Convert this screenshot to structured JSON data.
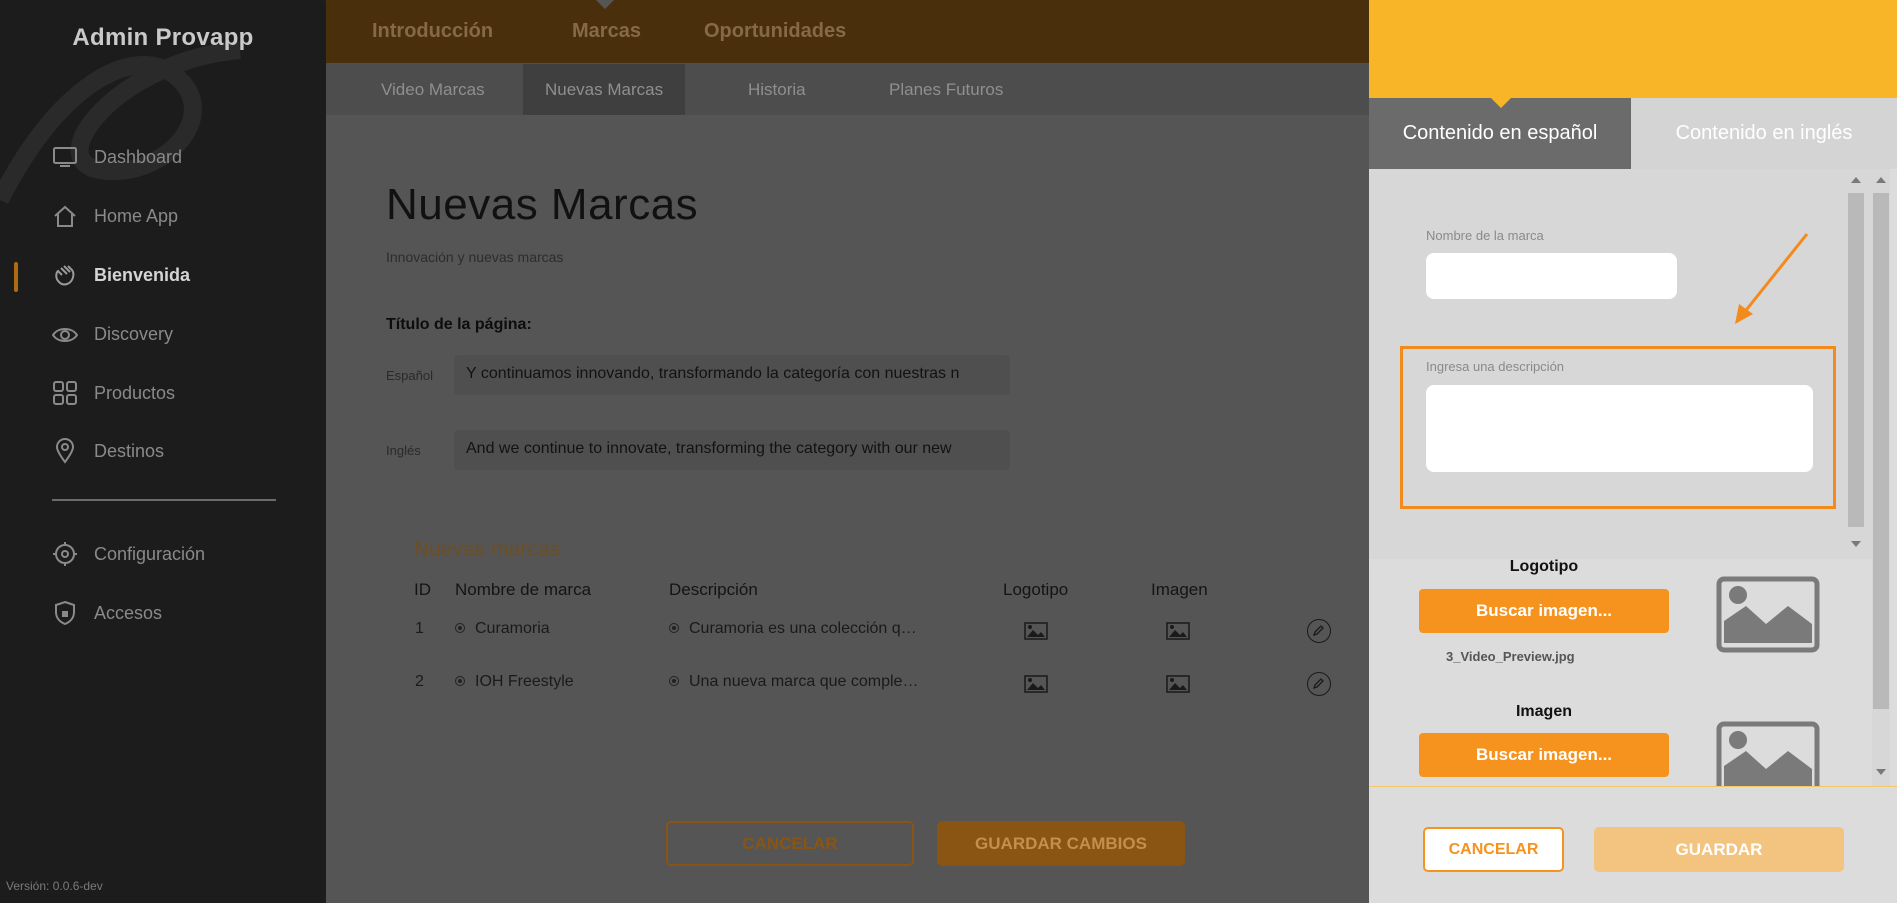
{
  "sidebar": {
    "app_title": "Admin Provapp",
    "items": [
      {
        "label": "Dashboard",
        "icon": "monitor-icon"
      },
      {
        "label": "Home App",
        "icon": "home-icon"
      },
      {
        "label": "Bienvenida",
        "icon": "wave-hand-icon",
        "active": true
      },
      {
        "label": "Discovery",
        "icon": "eye-icon"
      },
      {
        "label": "Productos",
        "icon": "grid-icon"
      },
      {
        "label": "Destinos",
        "icon": "map-pin-icon"
      },
      {
        "label": "Configuración",
        "icon": "gear-icon"
      },
      {
        "label": "Accesos",
        "icon": "shield-icon"
      }
    ],
    "version": "Versión: 0.0.6-dev"
  },
  "topnav": {
    "tabs": [
      "Introducción",
      "Marcas",
      "Oportunidades"
    ],
    "active_tab": "Marcas"
  },
  "subnav": {
    "tabs": [
      "Video Marcas",
      "Nuevas Marcas",
      "Historia",
      "Planes Futuros"
    ],
    "active_tab": "Nuevas Marcas"
  },
  "page": {
    "title": "Nuevas Marcas",
    "subtitle": "Innovación y nuevas marcas",
    "section_label": "Título de la página:",
    "spanish_label": "Español",
    "spanish_value": "Y continuamos innovando, transformando la categoría con nuestras n",
    "english_label": "Inglés",
    "english_value": "And we continue to innovate, transforming the category with our new"
  },
  "table": {
    "heading": "Nuevas marcas",
    "columns": [
      "ID",
      "Nombre de marca",
      "Descripción",
      "Logotipo",
      "Imagen"
    ],
    "rows": [
      {
        "id": "1",
        "name": "Curamoria",
        "description": "Curamoria es una colección q…"
      },
      {
        "id": "2",
        "name": "IOH Freestyle",
        "description": "Una nueva marca que comple…"
      }
    ]
  },
  "main_buttons": {
    "cancel": "CANCELAR",
    "save": "GUARDAR CAMBIOS"
  },
  "panel": {
    "tab_spanish": "Contenido en español",
    "tab_english": "Contenido en inglés",
    "brand_name_label": "Nombre de la marca",
    "brand_name_value": "",
    "description_label": "Ingresa una descripción",
    "description_value": "",
    "logo_title": "Logotipo",
    "logo_button": "Buscar imagen...",
    "logo_file": "3_Video_Preview.jpg",
    "image_title": "Imagen",
    "image_button": "Buscar imagen...",
    "cancel": "CANCELAR",
    "save": "GUARDAR"
  },
  "colors": {
    "accent": "#f6931e",
    "header_yellow": "#f8b527",
    "highlight": "#f28a1c",
    "sidebar": "#1c1c1c"
  }
}
